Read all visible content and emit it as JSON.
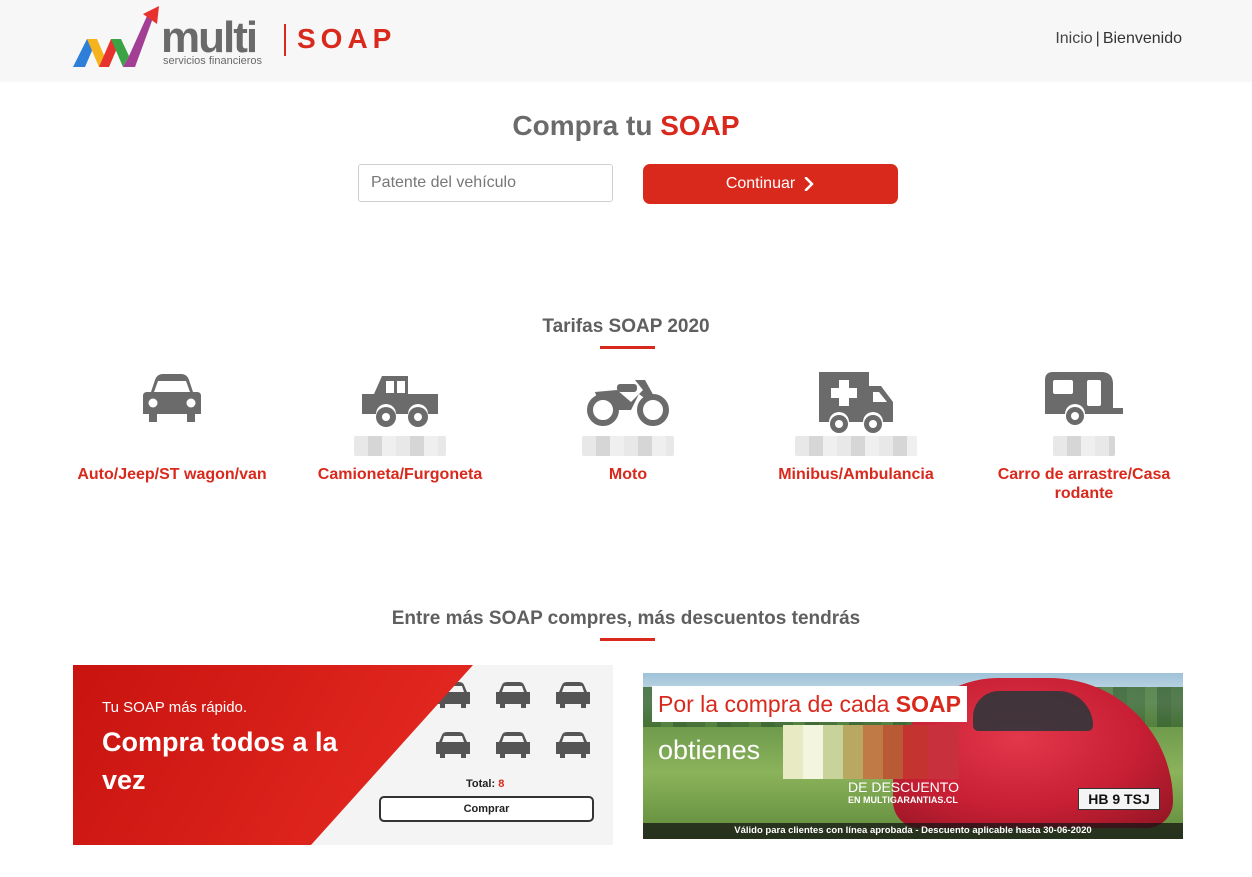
{
  "header": {
    "logo_text": "multi",
    "logo_subtitle": "servicios financieros",
    "product": "SOAP",
    "nav": [
      {
        "label": "Inicio"
      },
      {
        "label": "Bienvenido"
      }
    ],
    "nav_separator": "|"
  },
  "hero": {
    "title_prefix": "Compra tu",
    "title_accent": "SOAP",
    "plate_placeholder": "Patente del vehículo",
    "continue_label": "Continuar"
  },
  "tariffs": {
    "title": "Tarifas SOAP 2020",
    "vehicles": [
      {
        "label": "Auto/Jeep/ST wagon/van",
        "icon": "car-icon"
      },
      {
        "label": "Camioneta/Furgoneta",
        "icon": "pickup-truck-icon"
      },
      {
        "label": "Moto",
        "icon": "motorcycle-icon"
      },
      {
        "label": "Minibus/Ambulancia",
        "icon": "ambulance-icon"
      },
      {
        "label": "Carro de arrastre/Casa rodante",
        "icon": "caravan-icon"
      }
    ]
  },
  "discounts": {
    "title": "Entre más SOAP compres, más descuentos tendrás",
    "banner_left": {
      "small": "Tu SOAP más rápido.",
      "big": "Compra todos a la vez",
      "total_label": "Total:",
      "total_value": "8",
      "buy_label": "Comprar"
    },
    "banner_right": {
      "headline_prefix": "Por la compra de cada",
      "headline_accent": "SOAP",
      "obtain": "obtienes",
      "discount": "DE DESCUENTO",
      "url": "EN MULTIGARANTIAS.CL",
      "plate": "HB 9 TSJ",
      "footer": "Válido para clientes con línea aprobada  - Descuento aplicable hasta 30-06-2020"
    }
  },
  "colors": {
    "accent": "#d9291c",
    "icon_gray": "#6b6b6b",
    "header_bg": "#f7f7f8"
  }
}
